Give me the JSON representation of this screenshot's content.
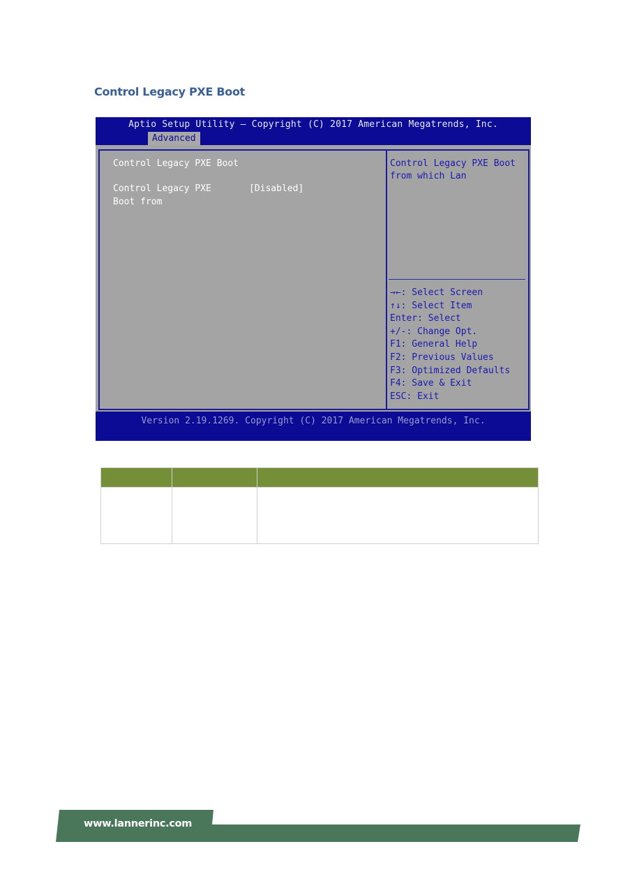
{
  "section": {
    "title": "Control Legacy PXE Boot"
  },
  "bios": {
    "title": "Aptio Setup Utility – Copyright (C) 2017 American Megatrends, Inc.",
    "active_tab": "Advanced",
    "page_heading": "Control Legacy PXE Boot",
    "setting": {
      "label_line1": "Control Legacy PXE",
      "label_line2": "Boot from",
      "value": "[Disabled]"
    },
    "help": {
      "line1": "Control Legacy PXE Boot",
      "line2": "from which Lan"
    },
    "keys": [
      {
        "key": "→←",
        "action": ": Select Screen"
      },
      {
        "key": "↑↓",
        "action": ": Select Item"
      },
      {
        "key": "Enter",
        "action": ": Select"
      },
      {
        "key": "+/-",
        "action": ": Change Opt."
      },
      {
        "key": "F1",
        "action": ": General Help"
      },
      {
        "key": "F2",
        "action": ": Previous Values"
      },
      {
        "key": "F3",
        "action": ": Optimized Defaults"
      },
      {
        "key": "F4",
        "action": ": Save & Exit"
      },
      {
        "key": "ESC",
        "action": ": Exit"
      }
    ],
    "footer": "Version 2.19.1269. Copyright (C) 2017 American Megatrends, Inc."
  },
  "table": {
    "headers": [
      "",
      "",
      ""
    ],
    "rows": [
      [
        "",
        "",
        ""
      ]
    ]
  },
  "footer": {
    "url": "www.lannerinc.com",
    "band_color": "#4a775a"
  }
}
